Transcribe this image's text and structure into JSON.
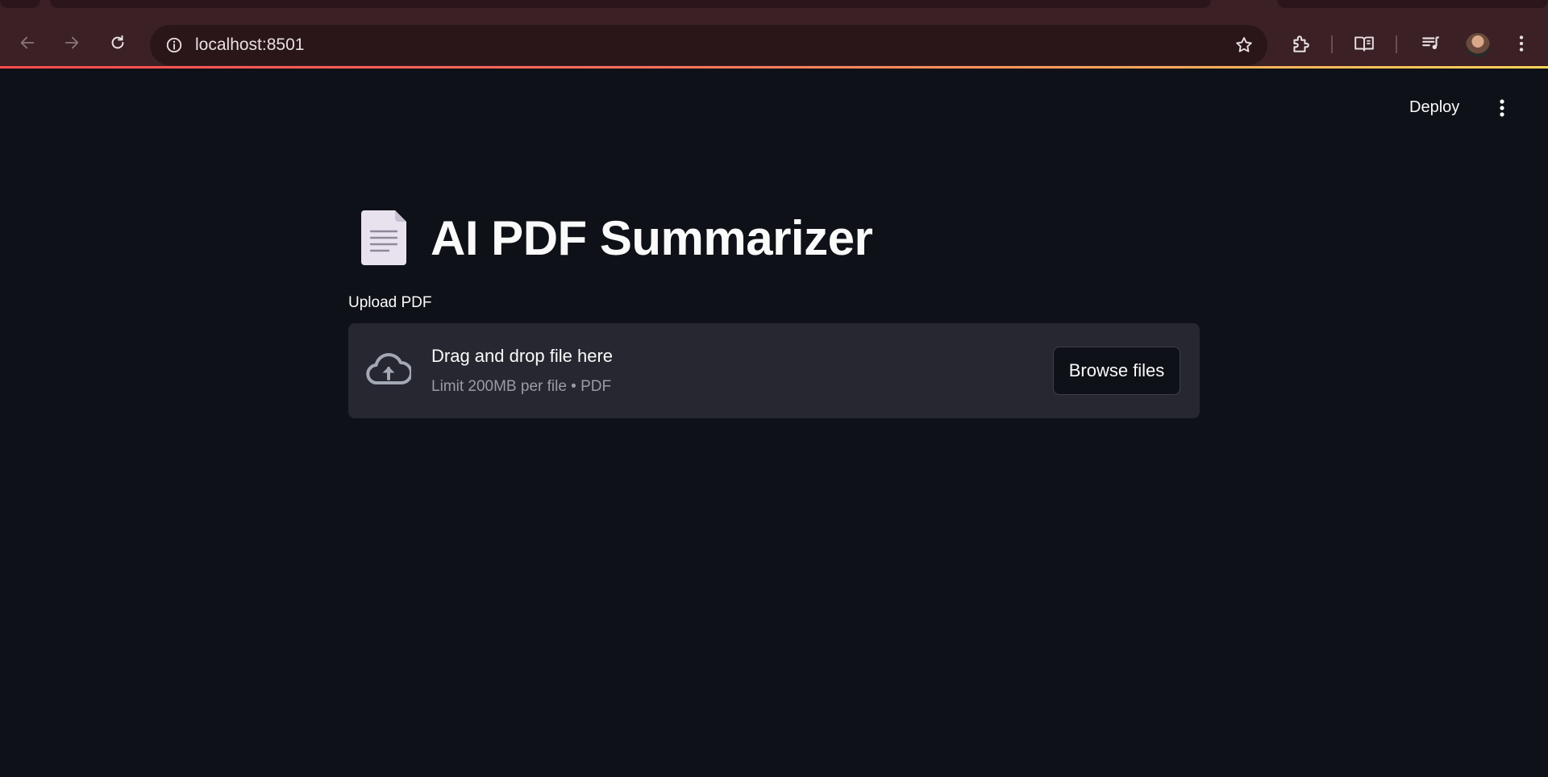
{
  "browser": {
    "url": "localhost:8501",
    "colors": {
      "chrome": "#3b2026",
      "omnibox": "#2a1519",
      "progress_start": "#ff4b4b",
      "progress_end": "#ffd35a"
    },
    "icons": {
      "back": "arrow-left-icon",
      "forward": "arrow-right-icon",
      "reload": "reload-icon",
      "site_info": "info-icon",
      "bookmark": "star-icon",
      "extensions": "puzzle-icon",
      "reading_mode": "book-open-icon",
      "media": "playlist-music-icon",
      "menu": "kebab-menu-icon"
    }
  },
  "app": {
    "deploy_label": "Deploy",
    "title": "AI PDF Summarizer",
    "title_icon": "document-icon",
    "uploader": {
      "label": "Upload PDF",
      "drop_text": "Drag and drop file here",
      "limit_text": "Limit 200MB per file • PDF",
      "browse_label": "Browse files",
      "icon": "cloud-upload-icon"
    },
    "colors": {
      "background": "#0e1117",
      "dropzone": "#262730",
      "text": "#fafafa",
      "muted": "#9a9ca4"
    }
  }
}
